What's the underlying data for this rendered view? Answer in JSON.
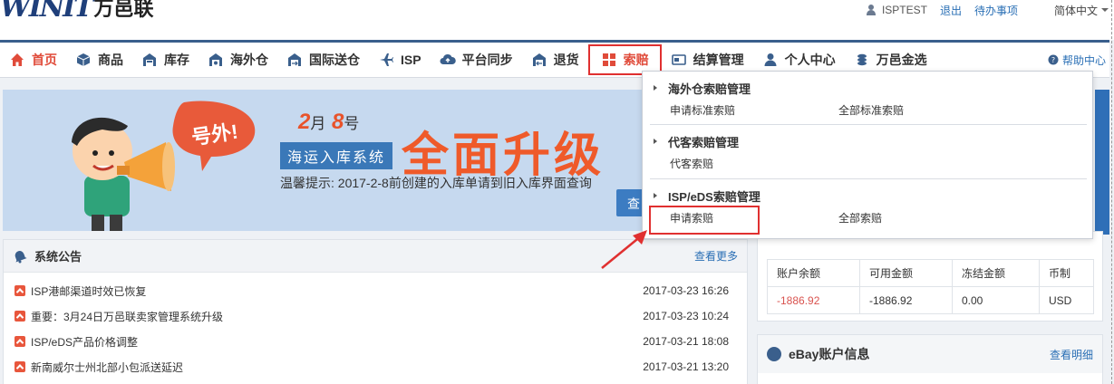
{
  "header": {
    "logo_mark": "WINIT",
    "logo_cn": "万邑联",
    "user": "ISPTEST",
    "logout": "退出",
    "todo": "待办事项",
    "language": "简体中文"
  },
  "nav": {
    "items": [
      {
        "label": "首页",
        "icon": "home-icon",
        "active": true
      },
      {
        "label": "商品",
        "icon": "cube-icon"
      },
      {
        "label": "库存",
        "icon": "warehouse-icon"
      },
      {
        "label": "海外仓",
        "icon": "overseas-warehouse-icon"
      },
      {
        "label": "国际送仓",
        "icon": "intl-delivery-icon"
      },
      {
        "label": "ISP",
        "icon": "plane-icon"
      },
      {
        "label": "平台同步",
        "icon": "cloud-sync-icon"
      },
      {
        "label": "退货",
        "icon": "return-icon"
      },
      {
        "label": "索赔",
        "icon": "grid-icon",
        "highlighted": true
      },
      {
        "label": "结算管理",
        "icon": "card-icon"
      },
      {
        "label": "个人中心",
        "icon": "user-icon"
      },
      {
        "label": "万邑金选",
        "icon": "coins-icon"
      }
    ],
    "help": "帮助中心"
  },
  "dropdown": {
    "sections": [
      {
        "title": "海外仓索赔管理",
        "links": [
          "申请标准索赔",
          "全部标准索赔"
        ]
      },
      {
        "title": "代客索赔管理",
        "links": [
          "代客索赔"
        ]
      },
      {
        "title": "ISP/eDS索赔管理",
        "links": [
          "申请索赔",
          "全部索赔"
        ]
      }
    ]
  },
  "banner": {
    "month": "2",
    "month_unit": "月",
    "day": "8",
    "day_unit": "号",
    "shout": "号外!",
    "system": "海运入库系统",
    "headline": "全面升级",
    "tip": "温馨提示: 2017-2-8前创建的入库单请到旧入库界面查询",
    "button": "查"
  },
  "notice": {
    "title": "系统公告",
    "more": "查看更多",
    "rows": [
      {
        "text": "ISP港邮渠道时效已恢复",
        "date": "2017-03-23 16:26"
      },
      {
        "text": "重要：3月24日万邑联卖家管理系统升级",
        "date": "2017-03-23 10:24"
      },
      {
        "text": "ISP/eDS产品价格调整",
        "date": "2017-03-21 18:08"
      },
      {
        "text": "新南威尔士州北部小包派送延迟",
        "date": "2017-03-21 13:20"
      }
    ]
  },
  "balance": {
    "headers": [
      "账户余额",
      "可用金额",
      "冻结金额",
      "币制"
    ],
    "row": [
      "-1886.92",
      "-1886.92",
      "0.00",
      "USD"
    ]
  },
  "ebay": {
    "title": "eBay账户信息",
    "more": "查看明细"
  },
  "colors": {
    "accent_red": "#e04b3a",
    "nav_border": "#3a5f8c",
    "link_blue": "#2a6fb5",
    "highlight_box": "#e03030"
  }
}
